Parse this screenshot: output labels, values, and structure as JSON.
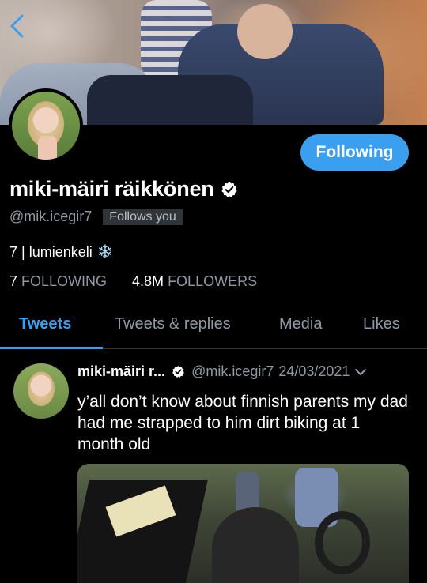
{
  "profile": {
    "display_name": "miki-mäiri räikkönen",
    "handle": "@mik.icegir7",
    "follows_you": "Follows you",
    "bio": "7 | lumienkeli",
    "bio_emoji": "❄",
    "follow_button": "Following"
  },
  "stats": {
    "following_count": "7",
    "following_label": "FOLLOWING",
    "followers_count": "4.8M",
    "followers_label": "FOLLOWERS"
  },
  "tabs": [
    {
      "label": "Tweets",
      "active": true
    },
    {
      "label": "Tweets & replies",
      "active": false
    },
    {
      "label": "Media",
      "active": false
    },
    {
      "label": "Likes",
      "active": false
    }
  ],
  "tweet": {
    "name": "miki-mäiri r...",
    "handle": "@mik.icegir7",
    "date": "24/03/2021",
    "text": "y’all don’t know about finnish parents my dad had me strapped to him dirt biking at 1 month old"
  },
  "colors": {
    "accent": "#3b9ff0",
    "background": "#000000",
    "muted_text": "#8f9aa4"
  },
  "icons": {
    "back": "chevron-left-icon",
    "verified": "verified-badge-icon",
    "menu": "chevron-down-icon"
  }
}
